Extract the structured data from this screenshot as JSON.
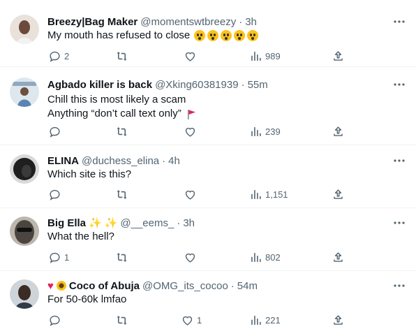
{
  "tweets": [
    {
      "name": "Breezy|Bag Maker",
      "handle": "@momentswtbreezy",
      "dot": "·",
      "time": "3h",
      "lines": [
        "My mouth has refused to close"
      ],
      "emoji_icons": [
        "astonished-face-emoji",
        "astonished-face-emoji",
        "astonished-face-emoji",
        "astonished-face-emoji",
        "astonished-face-emoji"
      ],
      "avatar_color": "#6b4a3c",
      "counts": {
        "reply": "2",
        "retweet": "",
        "like": "",
        "views": "989"
      }
    },
    {
      "name": "Agbado killer is back",
      "handle": "@Xking60381939",
      "dot": "·",
      "time": "55m",
      "lines": [
        "Chill this is most likely a scam",
        "Anything “don’t call text only”"
      ],
      "emoji_icons": [
        "red-flag-emoji"
      ],
      "avatar_color": "#c9d6df",
      "counts": {
        "reply": "",
        "retweet": "",
        "like": "",
        "views": "239"
      }
    },
    {
      "name": "ELINA",
      "handle": "@duchess_elina",
      "dot": "·",
      "time": "4h",
      "lines": [
        "Which site is this?"
      ],
      "emoji_icons": [],
      "avatar_color": "#2a2a2a",
      "counts": {
        "reply": "",
        "retweet": "",
        "like": "",
        "views": "1,151"
      }
    },
    {
      "name": "Big Ella",
      "handle": "@__eems_",
      "dot": "·",
      "time": "3h",
      "lines": [
        "What the hell?"
      ],
      "emoji_icons": [
        "sparkles-emoji",
        "sparkles-emoji"
      ],
      "avatar_color": "#4a4540",
      "counts": {
        "reply": "1",
        "retweet": "",
        "like": "",
        "views": "802"
      }
    },
    {
      "name": "Coco of Abuja",
      "handle": "@OMG_its_cocoo",
      "dot": "·",
      "time": "54m",
      "lines": [
        "For 50-60k lmfao"
      ],
      "emoji_icons": [
        "red-heart-emoji",
        "sunflower-emoji"
      ],
      "avatar_color": "#3b2b25",
      "counts": {
        "reply": "",
        "retweet": "",
        "like": "1",
        "views": "221"
      }
    }
  ],
  "colors": {
    "text": "#0f1419",
    "secondary": "#536471",
    "divider": "#eff3f4"
  },
  "icons": {
    "reply": "reply-icon",
    "retweet": "retweet-icon",
    "like": "heart-icon",
    "views": "views-icon",
    "share": "share-icon",
    "more": "more-icon"
  }
}
